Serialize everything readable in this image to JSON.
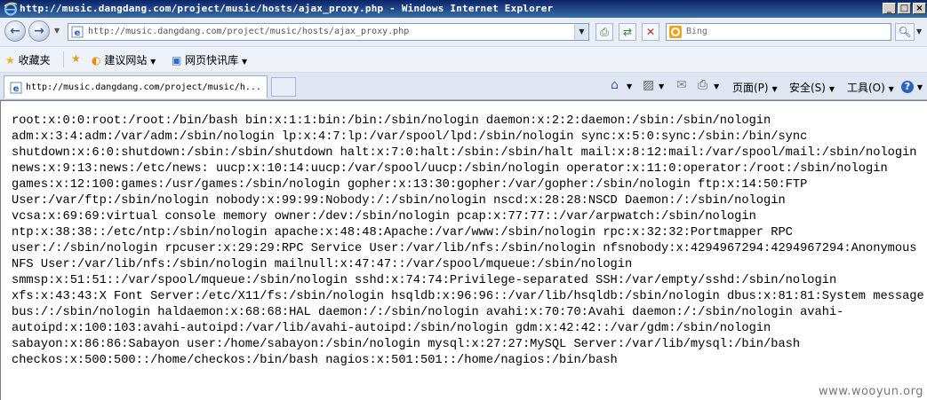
{
  "window": {
    "title": "http://music.dangdang.com/project/music/hosts/ajax_proxy.php - Windows Internet Explorer",
    "controls": {
      "minimize": "_",
      "maximize": "□",
      "close": "×"
    }
  },
  "address_bar": {
    "url": "http://music.dangdang.com/project/music/hosts/ajax_proxy.php",
    "back_icon": "back-arrow-icon",
    "forward_icon": "forward-arrow-icon"
  },
  "search": {
    "placeholder": "Bing"
  },
  "favorites_bar": {
    "favorites_label": "收藏夹",
    "suggested_sites_label": "建议网站",
    "web_slice_gallery_label": "网页快讯库"
  },
  "tabs": [
    {
      "label": "http://music.dangdang.com/project/music/h..."
    }
  ],
  "command_bar": {
    "page_label": "页面(P)",
    "safety_label": "安全(S)",
    "tools_label": "工具(O)"
  },
  "content": {
    "lines": [
      "root:x:0:0:root:/root:/bin/bash bin:x:1:1:bin:/bin:/sbin/nologin daemon:x:2:2:daemon:/sbin:/sbin/nologin",
      "adm:x:3:4:adm:/var/adm:/sbin/nologin lp:x:4:7:lp:/var/spool/lpd:/sbin/nologin sync:x:5:0:sync:/sbin:/bin/sync",
      "shutdown:x:6:0:shutdown:/sbin:/sbin/shutdown halt:x:7:0:halt:/sbin:/sbin/halt mail:x:8:12:mail:/var/spool/mail:/sbin/nologin",
      "news:x:9:13:news:/etc/news: uucp:x:10:14:uucp:/var/spool/uucp:/sbin/nologin operator:x:11:0:operator:/root:/sbin/nologin",
      "games:x:12:100:games:/usr/games:/sbin/nologin gopher:x:13:30:gopher:/var/gopher:/sbin/nologin ftp:x:14:50:FTP",
      "User:/var/ftp:/sbin/nologin nobody:x:99:99:Nobody:/:/sbin/nologin nscd:x:28:28:NSCD Daemon:/:/sbin/nologin",
      "vcsa:x:69:69:virtual console memory owner:/dev:/sbin/nologin pcap:x:77:77::/var/arpwatch:/sbin/nologin",
      "ntp:x:38:38::/etc/ntp:/sbin/nologin apache:x:48:48:Apache:/var/www:/sbin/nologin rpc:x:32:32:Portmapper RPC",
      "user:/:/sbin/nologin rpcuser:x:29:29:RPC Service User:/var/lib/nfs:/sbin/nologin nfsnobody:x:4294967294:4294967294:Anonymous",
      "NFS User:/var/lib/nfs:/sbin/nologin mailnull:x:47:47::/var/spool/mqueue:/sbin/nologin",
      "smmsp:x:51:51::/var/spool/mqueue:/sbin/nologin sshd:x:74:74:Privilege-separated SSH:/var/empty/sshd:/sbin/nologin",
      "xfs:x:43:43:X Font Server:/etc/X11/fs:/sbin/nologin hsqldb:x:96:96::/var/lib/hsqldb:/sbin/nologin dbus:x:81:81:System message",
      "bus:/:/sbin/nologin haldaemon:x:68:68:HAL daemon:/:/sbin/nologin avahi:x:70:70:Avahi daemon:/:/sbin/nologin avahi-",
      "autoipd:x:100:103:avahi-autoipd:/var/lib/avahi-autoipd:/sbin/nologin gdm:x:42:42::/var/gdm:/sbin/nologin",
      "sabayon:x:86:86:Sabayon user:/home/sabayon:/sbin/nologin mysql:x:27:27:MySQL Server:/var/lib/mysql:/bin/bash",
      "checkos:x:500:500::/home/checkos:/bin/bash nagios:x:501:501::/home/nagios:/bin/bash"
    ]
  },
  "watermark": "www.wooyun.org"
}
